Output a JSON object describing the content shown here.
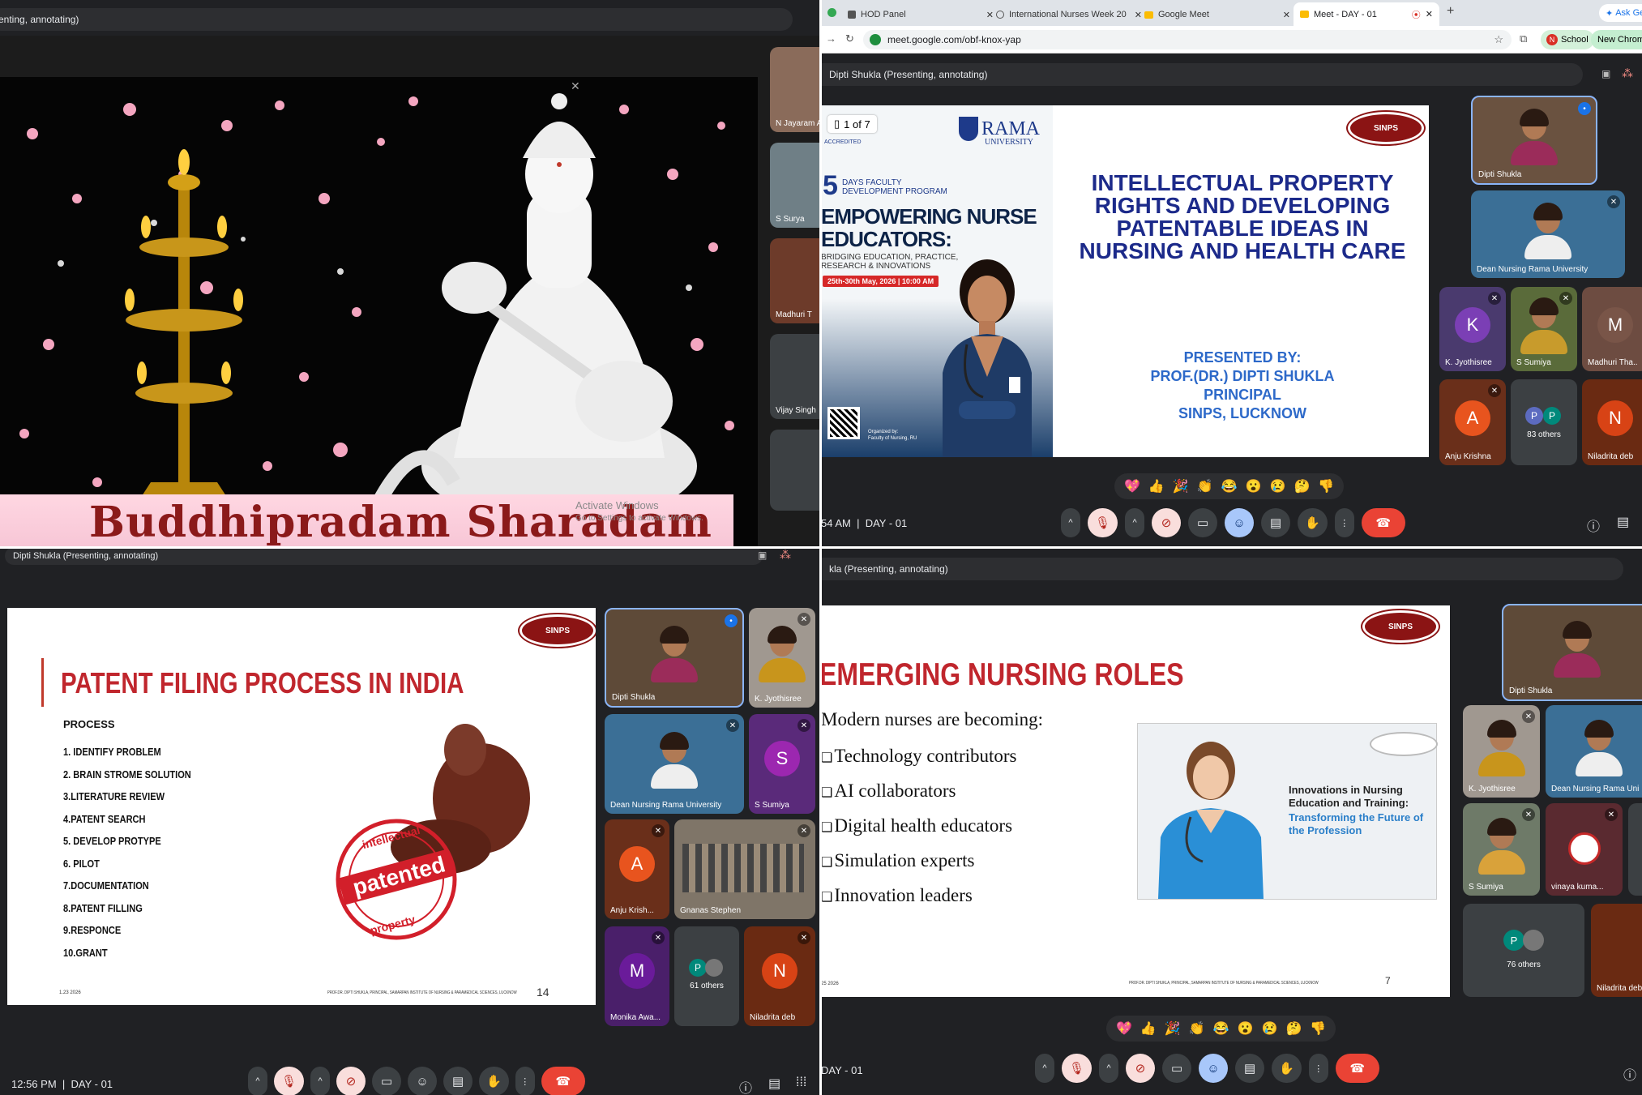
{
  "q1": {
    "presenter_bar": "enting, annotating)",
    "caption": "Buddhipradam Sharadam",
    "watermark_line1": "Activate Windows",
    "watermark_line2": "Go to Settings to activate Windows.",
    "side_tiles": [
      "N Jayaram A",
      "S Surya",
      "Madhuri T",
      "Vijay Singh"
    ]
  },
  "q2": {
    "tabs": [
      {
        "label": "HOD Panel",
        "icon": "panel-icon"
      },
      {
        "label": "International Nurses Week 20",
        "icon": "globe-icon"
      },
      {
        "label": "Google Meet",
        "icon": "meet-icon"
      },
      {
        "label": "Meet - DAY - 01",
        "icon": "meet-icon",
        "active": true
      }
    ],
    "ask_button": "Ask Ge",
    "url": "meet.google.com/obf-knox-yap",
    "profile_initial": "N",
    "profile_label": "School",
    "update_button": "New Chrome availab",
    "presenter_bar": "Dipti Shukla (Presenting, annotating)",
    "page_indicator": "1 of 7",
    "poster": {
      "university": "RAMA",
      "university_sub": "UNIVERSITY",
      "accredited": "ACCREDITED",
      "days": "5",
      "days_text1": "DAYS FACULTY",
      "days_text2": "DEVELOPMENT PROGRAM",
      "headline1": "EMPOWERING NURSE",
      "headline2": "EDUCATORS:",
      "sub1": "BRIDGING EDUCATION, PRACTICE,",
      "sub2": "RESEARCH & INNOVATIONS",
      "date": "25th-30th May, 2026 | 10:00 AM",
      "organized1": "Organized by:",
      "organized2": "Faculty of Nursing, RU"
    },
    "logo": "SINPS",
    "title": "INTELLECTUAL PROPERTY RIGHTS AND DEVELOPING PATENTABLE IDEAS IN NURSING AND HEALTH CARE",
    "presented_by": [
      "PRESENTED BY:",
      "PROF.(DR.) DIPTI SHUKLA",
      "PRINCIPAL",
      "SINPS, LUCKNOW"
    ],
    "participants": [
      {
        "name": "Dipti Shukla"
      },
      {
        "name": "Dean Nursing Rama University"
      },
      {
        "name": "K. Jyothisree",
        "initial": "K",
        "color": "#7b3fb5"
      },
      {
        "name": "S Sumiya"
      },
      {
        "name": "Madhuri Tha..",
        "initial": "M",
        "color": "#795548"
      },
      {
        "name": "Anju Krishna",
        "initial": "A",
        "color": "#e8541e"
      },
      {
        "name": "83 others",
        "initial": "P",
        "initial2": "P"
      },
      {
        "name": "Niladrita deb",
        "initial": "N",
        "color": "#d84315"
      }
    ],
    "reactions": [
      "💖",
      "👍",
      "🎉",
      "👏",
      "😂",
      "😮",
      "😢",
      "🤔",
      "👎"
    ],
    "clock": "54 AM",
    "meeting": "DAY - 01"
  },
  "q3": {
    "presenter_bar": "Dipti Shukla (Presenting, annotating)",
    "logo": "SINPS",
    "title": "PATENT FILING PROCESS IN INDIA",
    "list_header": "PROCESS",
    "steps": [
      "1. IDENTIFY PROBLEM",
      "2. BRAIN STROME SOLUTION",
      "3.LITERATURE REVIEW",
      "4.PATENT SEARCH",
      "5. DEVELOP PROTYPE",
      "6. PILOT",
      "7.DOCUMENTATION",
      "8.PATENT FILLING",
      "9.RESPONCE",
      "10.GRANT"
    ],
    "stamp_text": "patented",
    "stamp_ring_top": "intellectual",
    "stamp_ring_bottom": "property",
    "footer_left": "1.23 2026",
    "footer_right": "PROF.DR. DIPTI SHUKLA, PRINCIPAL, SAMARPAN INSTITUTE OF NURSING & PARAMEDICAL SCIENCES, LUCKNOW",
    "page_no": "14",
    "participants": [
      {
        "name": "Dipti Shukla"
      },
      {
        "name": "K. Jyothisree"
      },
      {
        "name": "Dean Nursing Rama University"
      },
      {
        "name": "S Sumiya",
        "initial": "S",
        "color": "#9c27b0"
      },
      {
        "name": "Anju Krish...",
        "initial": "A",
        "color": "#e8541e"
      },
      {
        "name": "Gnanas Stephen"
      },
      {
        "name": "Monika Awa...",
        "initial": "M",
        "color": "#6a1b9a"
      },
      {
        "name": "61 others",
        "initial": "P"
      },
      {
        "name": "Niladrita deb",
        "initial": "N",
        "color": "#d84315"
      }
    ],
    "clock": "12:56 PM",
    "meeting": "DAY - 01"
  },
  "q4": {
    "presenter_bar": "kla (Presenting, annotating)",
    "logo": "SINPS",
    "title": "EMERGING NURSING ROLES",
    "intro": "Modern nurses are becoming:",
    "bullets": [
      "Technology contributors",
      "AI collaborators",
      "Digital health educators",
      "Simulation experts",
      "Innovation leaders"
    ],
    "image_text1": "Innovations in Nursing Education and Training:",
    "image_text2": "Transforming the Future of the Profession",
    "footer_left": "25 2026",
    "footer_right": "PROF.DR. DIPTI SHUKLA, PRINCIPAL, SAMARPAN INSTITUTE OF NURSING & PARAMEDICAL SCIENCES, LUCKNOW",
    "page_no": "7",
    "participants": [
      {
        "name": "Dipti Shukla"
      },
      {
        "name": "K. Jyothisree"
      },
      {
        "name": "Dean Nursing Rama Uni"
      },
      {
        "name": "S Sumiya"
      },
      {
        "name": "vinaya kuma..."
      },
      {
        "name": "76 others",
        "initial": "P"
      },
      {
        "name": "Niladrita deb"
      }
    ],
    "reactions": [
      "💖",
      "👍",
      "🎉",
      "👏",
      "😂",
      "😮",
      "😢",
      "🤔",
      "👎"
    ],
    "meeting": "DAY - 01"
  }
}
